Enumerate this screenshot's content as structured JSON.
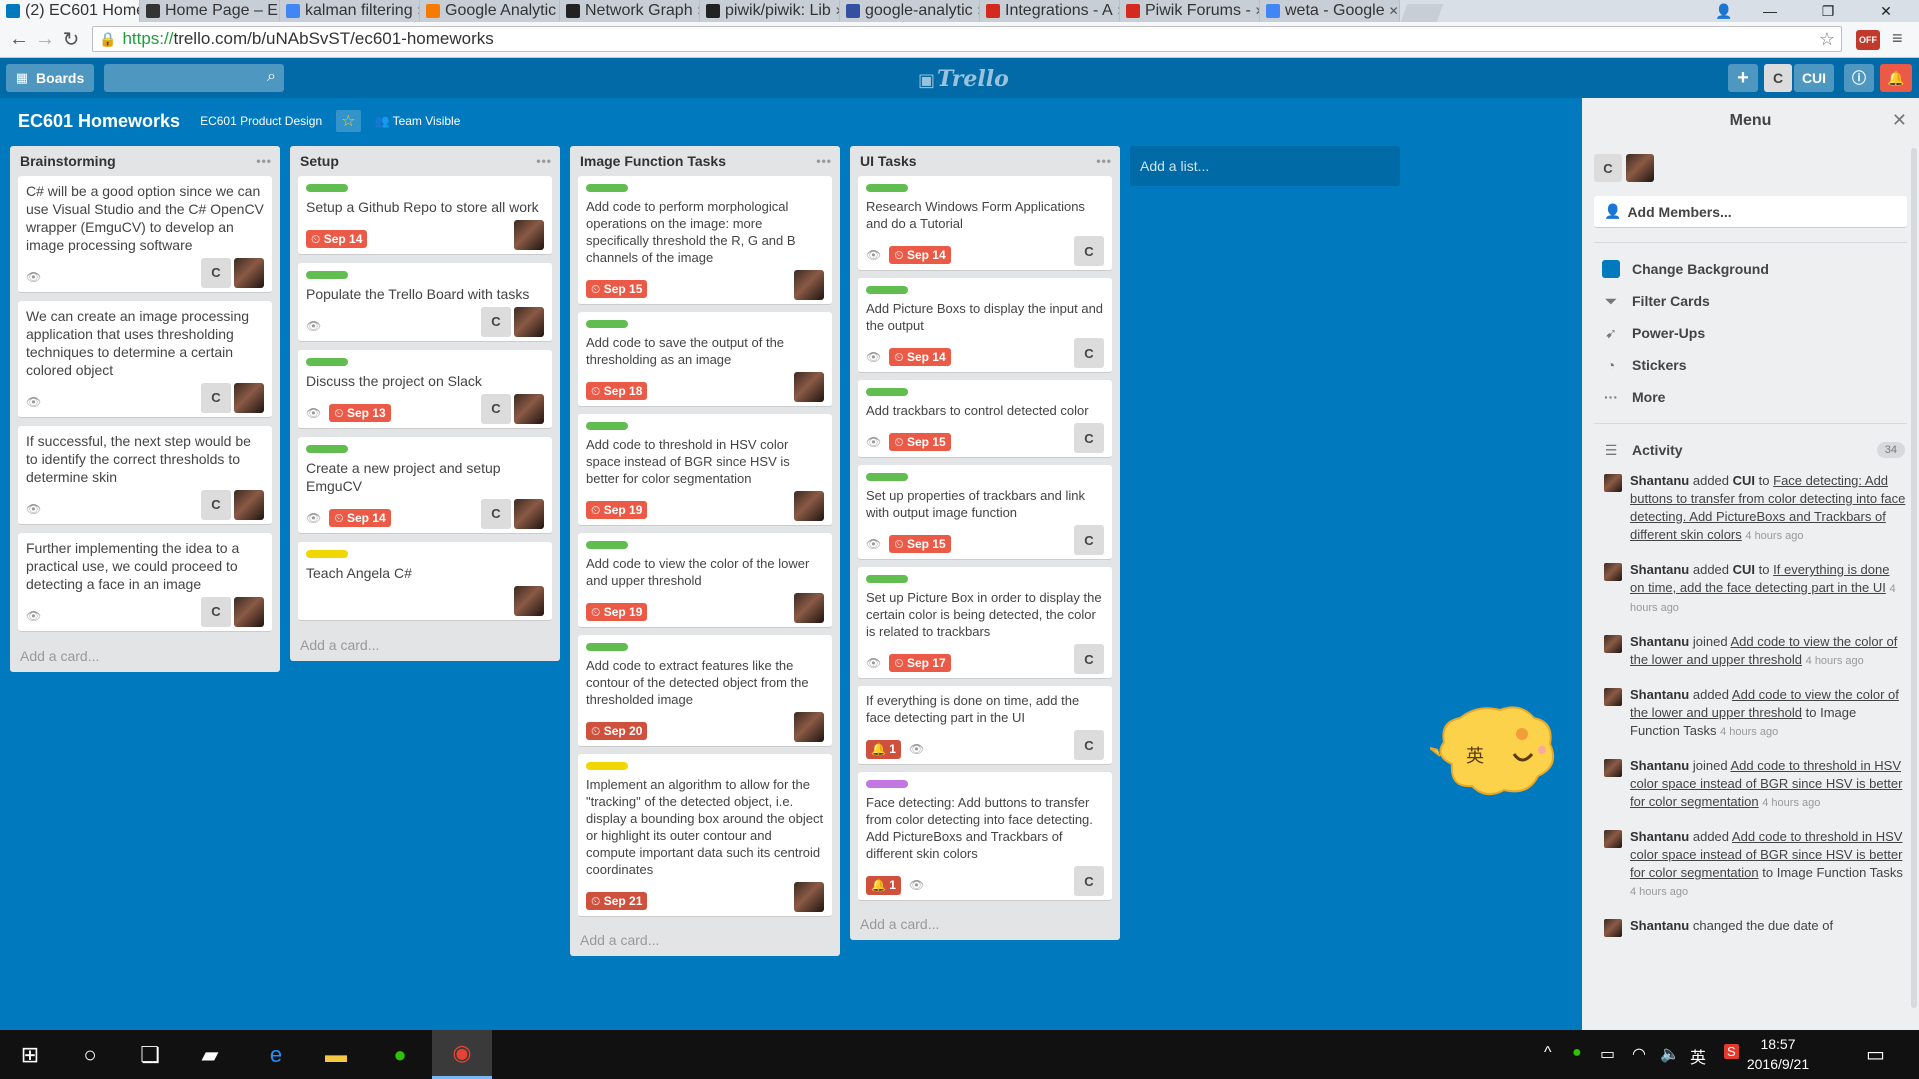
{
  "browser": {
    "tabs": [
      {
        "title": "(2) EC601 Home",
        "icon": "trello-icon",
        "color": "#0079bf",
        "active": true
      },
      {
        "title": "Home Page – E",
        "icon": "imdb-icon",
        "color": "#333333"
      },
      {
        "title": "kalman filtering",
        "icon": "google-icon",
        "color": "#4285f4"
      },
      {
        "title": "Google Analytic",
        "icon": "analytics-icon",
        "color": "#f57c00"
      },
      {
        "title": "Network Graph",
        "icon": "github-icon",
        "color": "#222222"
      },
      {
        "title": "piwik/piwik: Lib",
        "icon": "github-icon",
        "color": "#222222"
      },
      {
        "title": "google-analytic",
        "icon": "piwik-icon",
        "color": "#3450a3"
      },
      {
        "title": "Integrations - A",
        "icon": "piwik-icon",
        "color": "#d4291f"
      },
      {
        "title": "Piwik Forums -",
        "icon": "piwik-icon",
        "color": "#d4291f"
      },
      {
        "title": "weta - Google",
        "icon": "google-icon",
        "color": "#4285f4"
      }
    ],
    "url_scheme": "https://",
    "url_rest": "trello.com/b/uNAbSvST/ec601-homeworks"
  },
  "header": {
    "boards_label": "Boards",
    "logo": "Trello",
    "user_initial": "C",
    "user_name": "CUI"
  },
  "board": {
    "title": "EC601 Homeworks",
    "team": "EC601 Product Design",
    "visibility": "Team Visible",
    "add_list": "Add a list...",
    "add_card": "Add a card..."
  },
  "lists": [
    {
      "name": "Brainstorming",
      "cards": [
        {
          "text": "C# will be a good option since we can use Visual Studio and the C# OpenCV wrapper (EmguCV) to develop an image processing software"
        },
        {
          "text": "We can create an image processing application that uses thresholding techniques to determine a certain colored object"
        },
        {
          "text": "If successful, the next step would be to identify the correct thresholds to determine skin"
        },
        {
          "text": "Further implementing the idea to a practical use, we could proceed to detecting a face in an image"
        }
      ]
    },
    {
      "name": "Setup",
      "cards": [
        {
          "text": "Setup a Github Repo to store all work",
          "due": "Sep 14"
        },
        {
          "text": "Populate the Trello Board with tasks"
        },
        {
          "text": "Discuss the project on Slack",
          "due": "Sep 13"
        },
        {
          "text": "Create a new project and setup EmguCV",
          "due": "Sep 14"
        },
        {
          "text": "Teach Angela C#"
        }
      ]
    },
    {
      "name": "Image Function Tasks",
      "cards": [
        {
          "text": "Add code to perform morphological operations on the image: more specifically threshold the R, G and B channels of the image",
          "due": "Sep 15"
        },
        {
          "text": "Add code to save the output of the thresholding as an image",
          "due": "Sep 18"
        },
        {
          "text": "Add code to threshold in HSV color space instead of BGR since HSV is better for color segmentation",
          "due": "Sep 19"
        },
        {
          "text": "Add code to view the color of the lower and upper threshold",
          "due": "Sep 19"
        },
        {
          "text": "Add code to extract features like the contour of the detected object from the thresholded image",
          "due": "Sep 20"
        },
        {
          "text": "Implement an algorithm to allow for the \"tracking\" of the detected object, i.e. display a bounding box around the object or highlight its outer contour and compute important data such its centroid coordinates",
          "due": "Sep 21"
        }
      ]
    },
    {
      "name": "UI Tasks",
      "cards": [
        {
          "text": "Research Windows Form Applications and do a Tutorial",
          "due": "Sep 14"
        },
        {
          "text": "Add Picture Boxs to display the input and the output",
          "due": "Sep 14"
        },
        {
          "text": "Add trackbars to control detected color",
          "due": "Sep 15"
        },
        {
          "text": "Set up properties of trackbars and link with output image function",
          "due": "Sep 15"
        },
        {
          "text": "Set up Picture Box in order to display the certain color is being detected, the color is related to trackbars",
          "due": "Sep 17"
        },
        {
          "text": "If everything is done on time, add the face detecting part in the UI",
          "notifications": "1"
        },
        {
          "text": "Face detecting: Add buttons to transfer from color detecting into face detecting. Add PictureBoxs and Trackbars of different skin colors",
          "notifications": "1"
        }
      ]
    }
  ],
  "menu": {
    "title": "Menu",
    "member_initial": "C",
    "add_members": "Add Members...",
    "items": [
      "Change Background",
      "Filter Cards",
      "Power-Ups",
      "Stickers",
      "More"
    ],
    "background_color": "#0079bf",
    "activity_label": "Activity",
    "activity_count": "34",
    "activity": [
      {
        "user": "Shantanu",
        "verb": "added",
        "target": "CUI",
        "prep": "to",
        "link": "Face detecting: Add buttons to transfer from color detecting into face detecting. Add PictureBoxs and Trackbars of different skin colors",
        "suffix": "",
        "time": "4 hours ago"
      },
      {
        "user": "Shantanu",
        "verb": "added",
        "target": "CUI",
        "prep": "to",
        "link": "If everything is done on time, add the face detecting part in the UI",
        "suffix": "",
        "time": "4 hours ago"
      },
      {
        "user": "Shantanu",
        "verb": "joined",
        "target": "",
        "prep": "",
        "link": "Add code to view the color of the lower and upper threshold",
        "suffix": "",
        "time": "4 hours ago"
      },
      {
        "user": "Shantanu",
        "verb": "added",
        "target": "",
        "prep": "",
        "link": "Add code to view the color of the lower and upper threshold",
        "suffix": "to Image Function Tasks",
        "time": "4 hours ago"
      },
      {
        "user": "Shantanu",
        "verb": "joined",
        "target": "",
        "prep": "",
        "link": "Add code to threshold in HSV color space instead of BGR since HSV is better for color segmentation",
        "suffix": "",
        "time": "4 hours ago"
      },
      {
        "user": "Shantanu",
        "verb": "added",
        "target": "",
        "prep": "",
        "link": "Add code to threshold in HSV color space instead of BGR since HSV is better for color segmentation",
        "suffix": "to Image Function Tasks",
        "time": "4 hours ago"
      },
      {
        "user": "Shantanu",
        "verb": "changed the due date of",
        "target": "",
        "prep": "",
        "link": "",
        "suffix": "",
        "time": ""
      }
    ]
  },
  "ime": {
    "char": "英"
  },
  "taskbar": {
    "time": "18:57",
    "date": "2016/9/21",
    "ime": "英"
  },
  "colors": {
    "board_bg": "#0079bf",
    "header_bg": "#026aa7",
    "label_green": "#61bd4f",
    "label_yellow": "#f2d600",
    "label_purple": "#c377e0",
    "due_red": "#eb5a46"
  }
}
